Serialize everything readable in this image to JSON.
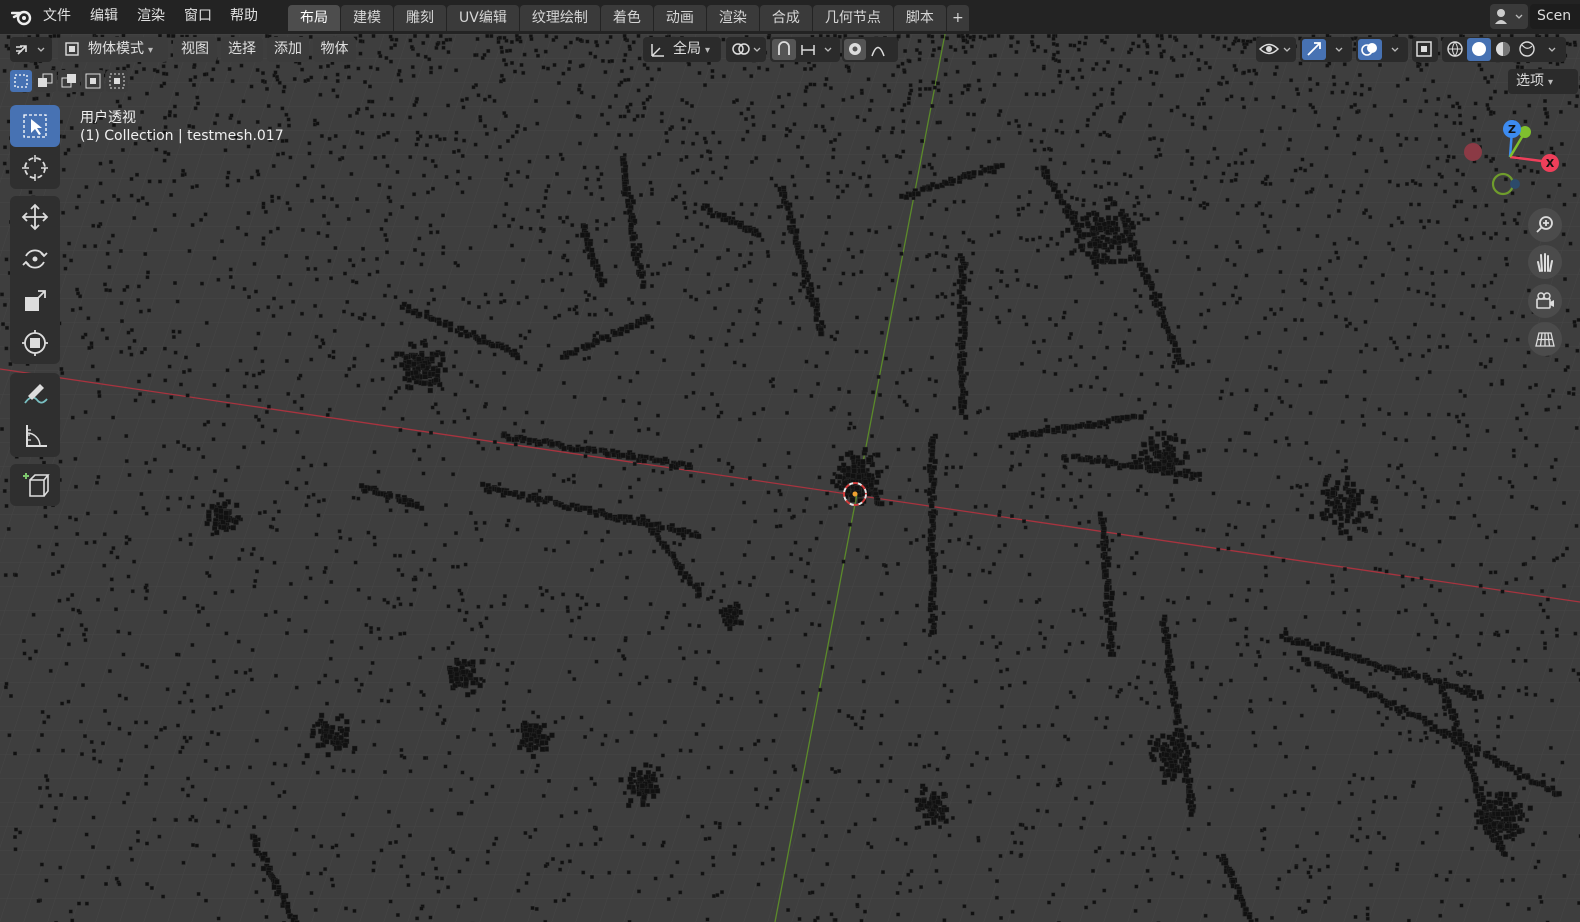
{
  "menu": [
    "文件",
    "编辑",
    "渲染",
    "窗口",
    "帮助"
  ],
  "workspaces": [
    "布局",
    "建模",
    "雕刻",
    "UV编辑",
    "纹理绘制",
    "着色",
    "动画",
    "渲染",
    "合成",
    "几何节点",
    "脚本"
  ],
  "active_workspace": "布局",
  "add_workspace": "+",
  "scene_name": "Scen",
  "header": {
    "mode": "物体模式",
    "view": "视图",
    "select": "选择",
    "add": "添加",
    "object": "物体",
    "transform_orientation": "全局",
    "options": "选项"
  },
  "viewport_info": {
    "view_name": "用户透视",
    "collection": "(1) Collection | testmesh.017"
  },
  "gizmo": {
    "x": "X",
    "y": "Y",
    "z": "Z"
  },
  "colors": {
    "accent": "#4772b3",
    "x_axis": "#ee3f5a",
    "y_axis": "#7fbf2e",
    "z_axis": "#3d8bf0"
  },
  "tools": [
    "select-box",
    "cursor",
    "move",
    "rotate",
    "scale",
    "transform",
    "annotate",
    "measure",
    "add-cube"
  ],
  "nav_icons": [
    "zoom-icon",
    "hand-icon",
    "camera-icon",
    "grid-icon"
  ]
}
